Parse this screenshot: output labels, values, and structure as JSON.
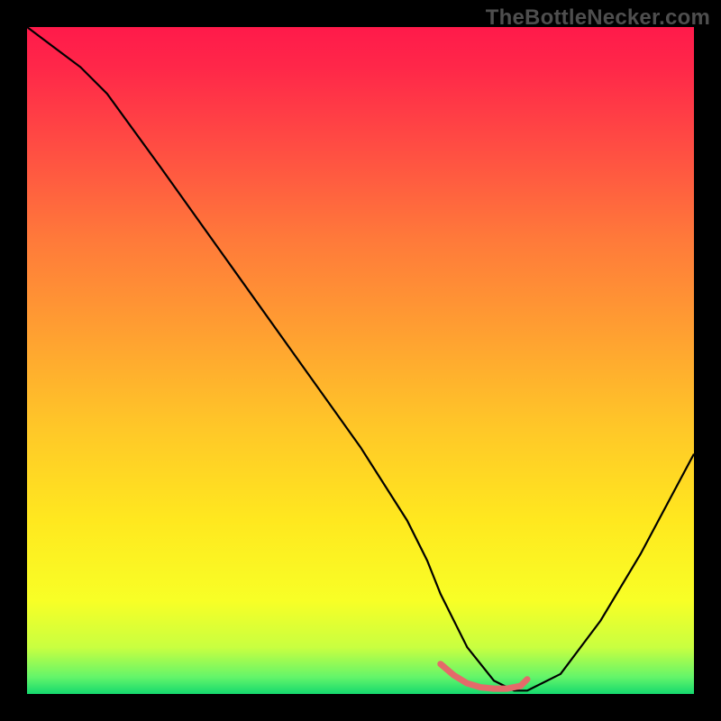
{
  "watermark": "TheBottleNecker.com",
  "gradient_stops": [
    {
      "offset": 0.0,
      "color": "#ff1a4a"
    },
    {
      "offset": 0.06,
      "color": "#ff2749"
    },
    {
      "offset": 0.18,
      "color": "#ff4d43"
    },
    {
      "offset": 0.32,
      "color": "#ff7a3a"
    },
    {
      "offset": 0.46,
      "color": "#ffa031"
    },
    {
      "offset": 0.6,
      "color": "#ffc728"
    },
    {
      "offset": 0.74,
      "color": "#ffe81f"
    },
    {
      "offset": 0.86,
      "color": "#f8ff26"
    },
    {
      "offset": 0.93,
      "color": "#c9ff40"
    },
    {
      "offset": 0.975,
      "color": "#63f56a"
    },
    {
      "offset": 1.0,
      "color": "#15d96e"
    }
  ],
  "chart_data": {
    "type": "line",
    "title": "",
    "xlabel": "",
    "ylabel": "",
    "xlim": [
      0,
      100
    ],
    "ylim": [
      0,
      100
    ],
    "series": [
      {
        "name": "curve",
        "stroke": "#000000",
        "stroke_width": 2.2,
        "x": [
          0,
          4,
          8,
          12,
          20,
          30,
          40,
          50,
          57,
          60,
          62,
          66,
          70,
          73,
          75,
          80,
          86,
          92,
          100
        ],
        "values": [
          100,
          97,
          94,
          90,
          79,
          65,
          51,
          37,
          26,
          20,
          15,
          7,
          2,
          0.5,
          0.5,
          3,
          11,
          21,
          36
        ]
      },
      {
        "name": "sweet-spot",
        "stroke": "#e46a6a",
        "stroke_width": 7,
        "linecap": "round",
        "x": [
          62,
          64,
          66,
          68,
          70,
          72,
          74,
          75
        ],
        "values": [
          4.5,
          2.8,
          1.6,
          1.0,
          0.8,
          0.8,
          1.2,
          2.2
        ]
      }
    ]
  }
}
